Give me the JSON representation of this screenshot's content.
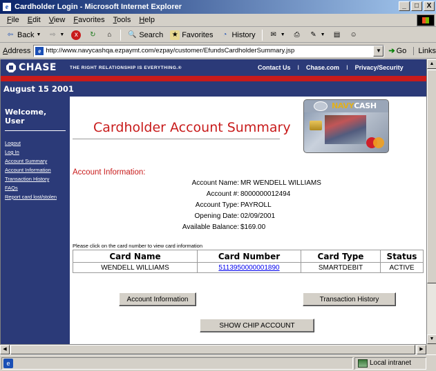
{
  "window": {
    "title": "Cardholder Login - Microsoft Internet Explorer",
    "buttons": [
      "_",
      "□",
      "X"
    ]
  },
  "menu": [
    "File",
    "Edit",
    "View",
    "Favorites",
    "Tools",
    "Help"
  ],
  "toolbar": {
    "back": "Back",
    "search": "Search",
    "favorites": "Favorites",
    "history": "History"
  },
  "address": {
    "label": "Address",
    "url": "http://www.navycashqa.ezpaymt.com/ezpay/customer/EfundsCardholderSummary.jsp",
    "go": "Go",
    "links": "Links"
  },
  "header": {
    "logo": "CHASE",
    "tagline": "THE RIGHT RELATIONSHIP IS EVERYTHING.®",
    "links": [
      "Contact Us",
      "Chase.com",
      "Privacy/Security"
    ],
    "separator": "I",
    "date": "August 15 2001"
  },
  "sidebar": {
    "welcome": "Welcome, User",
    "items": [
      "Logout",
      "Log In",
      "Account Summary",
      "Account Information",
      "Transaction History",
      "FAQs",
      "Report card lost/stolen"
    ]
  },
  "page": {
    "title": "Cardholder Account Summary",
    "card_brand_prefix": "NAVY",
    "card_brand_suffix": "CASH"
  },
  "account": {
    "heading": "Account Information:",
    "fields": [
      {
        "label": "Account Name:",
        "value": "MR WENDELL WILLIAMS"
      },
      {
        "label": "Account #:",
        "value": "8000000012494"
      },
      {
        "label": "Account Type:",
        "value": "PAYROLL"
      },
      {
        "label": "Opening Date:",
        "value": "02/09/2001"
      },
      {
        "label": "Available Balance:",
        "value": "$169.00"
      }
    ]
  },
  "cards": {
    "hint": "Please click on the card number to view card information",
    "columns": [
      "Card Name",
      "Card Number",
      "Card Type",
      "Status"
    ],
    "rows": [
      {
        "name": "WENDELL WILLIAMS",
        "number": "5113950000001890",
        "type": "SMARTDEBIT",
        "status": "ACTIVE"
      }
    ]
  },
  "buttons": {
    "account_info": "Account Information",
    "transaction_history": "Transaction History",
    "show_chip": "SHOW CHIP ACCOUNT"
  },
  "status": {
    "zone": "Local intranet"
  }
}
